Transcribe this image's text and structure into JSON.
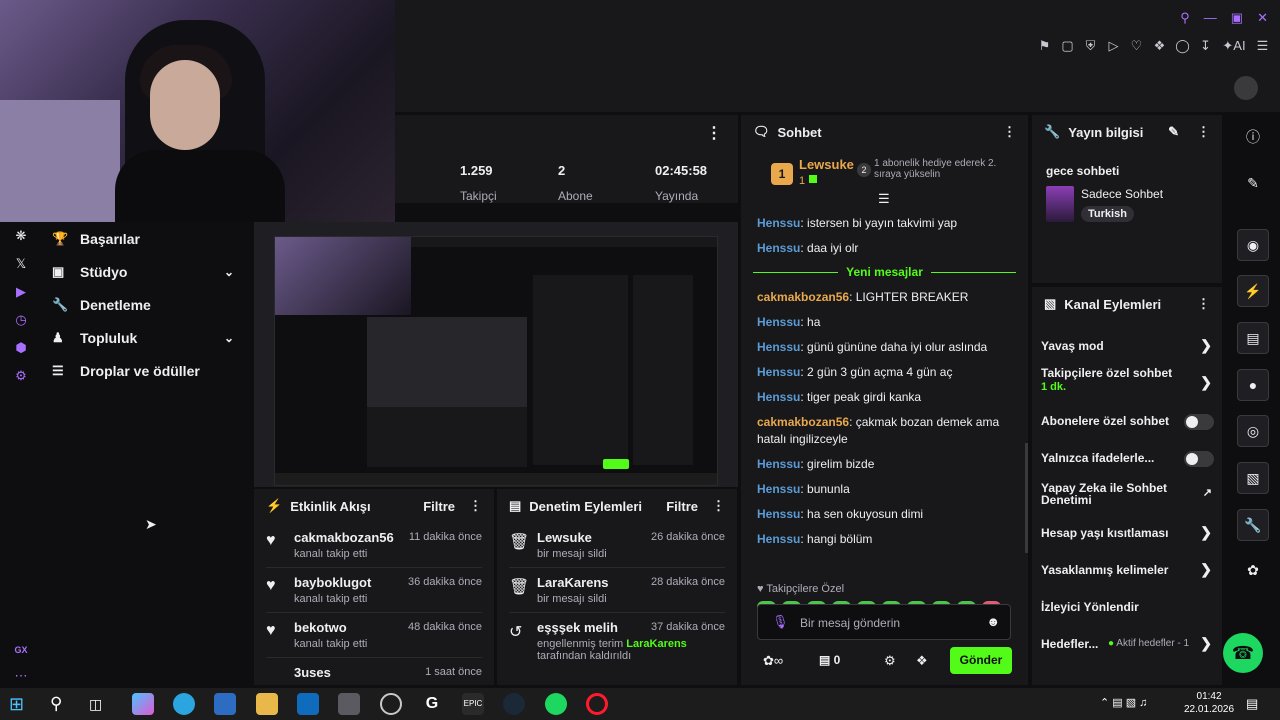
{
  "topbar": {
    "ai_label": "AI",
    "icons": [
      "bookmark-icon",
      "crop-icon",
      "shield-icon",
      "play-icon",
      "heart-icon",
      "puzzle-icon",
      "user-icon",
      "download-icon",
      "ai-icon",
      "menu-icon"
    ]
  },
  "leftnav": {
    "items": [
      {
        "label": "Başarılar",
        "icon": "trophy-icon"
      },
      {
        "label": "Stüdyo",
        "icon": "video-icon",
        "expandable": true
      },
      {
        "label": "Denetleme",
        "icon": "wrench-icon"
      },
      {
        "label": "Topluluk",
        "icon": "people-icon",
        "expandable": true
      },
      {
        "label": "Droplar ve ödüller",
        "icon": "gift-icon"
      }
    ],
    "rail_label": "GX"
  },
  "stats": [
    {
      "value": "1.259",
      "label": "Takipçi"
    },
    {
      "value": "2",
      "label": "Abone"
    },
    {
      "value": "02:45:58",
      "label": "Yayında"
    }
  ],
  "activity": {
    "title": "Etkinlik Akışı",
    "filter": "Filtre",
    "items": [
      {
        "name": "cakmakbozan56",
        "text": "kanalı takip etti",
        "when": "11 dakika önce"
      },
      {
        "name": "bayboklugot",
        "text": "kanalı takip etti",
        "when": "36 dakika önce"
      },
      {
        "name": "bekotwo",
        "text": "kanalı takip etti",
        "when": "48 dakika önce"
      },
      {
        "name": "3uses",
        "text": "",
        "when": "1 saat önce"
      }
    ]
  },
  "moderation": {
    "title": "Denetim Eylemleri",
    "filter": "Filtre",
    "items": [
      {
        "name": "Lewsuke",
        "text": "bir mesajı sildi",
        "when": "26 dakika önce",
        "icon": "trash-icon"
      },
      {
        "name": "LaraKarens",
        "text": "bir mesajı sildi",
        "when": "28 dakika önce",
        "icon": "trash-icon"
      },
      {
        "name": "eşşşek melih",
        "text": "engellenmiş terim",
        "text_user": "LaraKarens",
        "text_end": "tarafından kaldırıldı",
        "when": "37 dakika önce",
        "icon": "undo-icon"
      }
    ]
  },
  "chat": {
    "title": "Sohbet",
    "leader": {
      "rank": "1",
      "name": "Lewsuke",
      "count": "1",
      "rank2": "2",
      "promo": "1 abonelik hediye ederek 2. sıraya yükselin"
    },
    "new_messages": "Yeni mesajlar",
    "messages": [
      {
        "user": "Henssu",
        "text": "istersen bi yayın takvimi yap",
        "color": "blue"
      },
      {
        "user": "Henssu",
        "text": "daa iyi olr",
        "color": "blue"
      },
      {
        "user": "cakmakbozan56",
        "text": "LIGHTER BREAKER",
        "color": "orange"
      },
      {
        "user": "Henssu",
        "text": "ha",
        "color": "blue"
      },
      {
        "user": "Henssu",
        "text": "günü gününe daha iyi olur aslında",
        "color": "blue"
      },
      {
        "user": "Henssu",
        "text": "2 gün 3 gün açma 4 gün aç",
        "color": "blue"
      },
      {
        "user": "Henssu",
        "text": "tiger peak girdi kanka",
        "color": "blue"
      },
      {
        "user": "cakmakbozan56",
        "text": "çakmak bozan demek ama hatalı ingilizceyle",
        "color": "orange"
      },
      {
        "user": "Henssu",
        "text": "girelim bizde",
        "color": "blue"
      },
      {
        "user": "Henssu",
        "text": "bununla",
        "color": "blue"
      },
      {
        "user": "Henssu",
        "text": "ha sen okuyosun dimi",
        "color": "blue"
      },
      {
        "user": "Henssu",
        "text": "hangi bölüm",
        "color": "blue"
      }
    ],
    "follower_only": "Takipçilere Özel",
    "input_placeholder": "Bir mesaj gönderin",
    "points": "0",
    "send": "Gönder"
  },
  "info": {
    "title": "Yayın bilgisi",
    "stream_title": "gece sohbeti",
    "category": "Sadece Sohbet",
    "tag": "Turkish"
  },
  "actions": {
    "title": "Kanal Eylemleri",
    "items": [
      {
        "label": "Yavaş mod",
        "type": "chevron"
      },
      {
        "label": "Takipçilere özel sohbet",
        "sub": "1 dk.",
        "type": "chevron"
      },
      {
        "label": "Abonelere özel sohbet",
        "type": "toggle"
      },
      {
        "label": "Yalnızca ifadelerle...",
        "type": "toggle"
      },
      {
        "label": "Yapay Zeka ile Sohbet Denetimi",
        "type": "external"
      },
      {
        "label": "Hesap yaşı kısıtlaması",
        "type": "chevron"
      },
      {
        "label": "Yasaklanmış kelimeler",
        "type": "chevron"
      },
      {
        "label": "İzleyici Yönlendir",
        "type": "none"
      },
      {
        "label": "Hedefler...",
        "sub": "Aktif hedefler - 1",
        "type": "chevron"
      }
    ]
  },
  "taskbar": {
    "time": "01:42",
    "date": "22.01.2026"
  },
  "colors": {
    "accent": "#53fc18",
    "purple": "#a970ff",
    "panel": "#18181b",
    "bg": "#0e0e10"
  }
}
